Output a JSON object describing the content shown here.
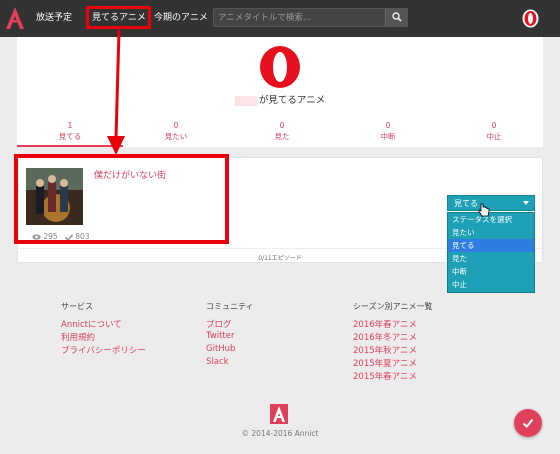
{
  "header": {
    "nav": [
      {
        "label": "放送予定"
      },
      {
        "label": "見てるアニメ"
      },
      {
        "label": "今期のアニメ"
      }
    ],
    "search_placeholder": "アニメタイトルで検索..."
  },
  "profile": {
    "title_suffix": "が見てるアニメ",
    "tabs": [
      {
        "count": "1",
        "label": "見てる"
      },
      {
        "count": "0",
        "label": "見たい"
      },
      {
        "count": "0",
        "label": "見た"
      },
      {
        "count": "0",
        "label": "中断"
      },
      {
        "count": "0",
        "label": "中止"
      }
    ]
  },
  "work": {
    "title": "僕だけがいない街",
    "watchers": "295",
    "checks": "803",
    "episode_progress": "0/11エピソード",
    "status_selected": "見てる",
    "status_options": [
      "ステータスを選択",
      "見たい",
      "見てる",
      "見た",
      "中断",
      "中止"
    ]
  },
  "footer": {
    "cols": [
      {
        "title": "サービス",
        "links": [
          "Annictについて",
          "利用規約",
          "プライバシーポリシー"
        ]
      },
      {
        "title": "コミュニティ",
        "links": [
          "ブログ",
          "Twitter",
          "GitHub",
          "Slack"
        ]
      },
      {
        "title": "シーズン別アニメ一覧",
        "links": [
          "2016年春アニメ",
          "2016年冬アニメ",
          "2015年秋アニメ",
          "2015年夏アニメ",
          "2015年春アニメ"
        ]
      }
    ],
    "copyright": "© 2014-2016 Annict"
  },
  "colors": {
    "accent": "#e0405a",
    "header": "#333333",
    "select": "#1ea0b6",
    "highlight": "#e8000b"
  }
}
